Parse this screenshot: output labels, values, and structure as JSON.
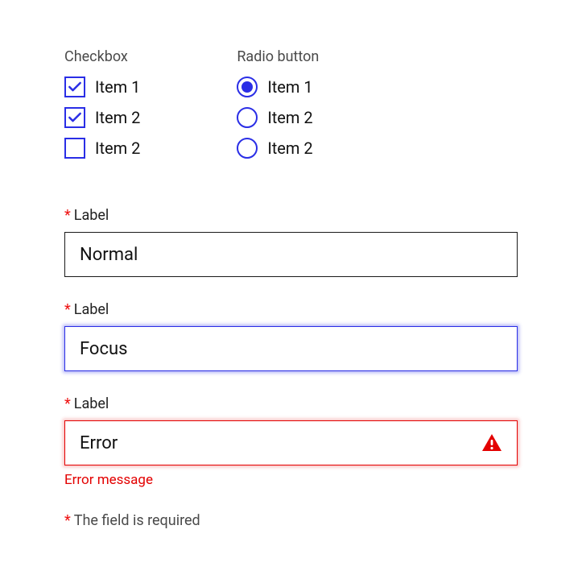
{
  "colors": {
    "accent": "#2a2ee6",
    "error": "#e30000",
    "text": "#111111",
    "muted": "#4a4a4a"
  },
  "checkbox_group": {
    "heading": "Checkbox",
    "items": [
      {
        "label": "Item 1",
        "checked": true
      },
      {
        "label": "Item 2",
        "checked": true
      },
      {
        "label": "Item 2",
        "checked": false
      }
    ]
  },
  "radio_group": {
    "heading": "Radio button",
    "items": [
      {
        "label": "Item 1",
        "selected": true
      },
      {
        "label": "Item 2",
        "selected": false
      },
      {
        "label": "Item 2",
        "selected": false
      }
    ]
  },
  "text_fields": {
    "normal": {
      "label": "Label",
      "required_mark": "*",
      "value": "Normal"
    },
    "focus": {
      "label": "Label",
      "required_mark": "*",
      "value": "Focus"
    },
    "error": {
      "label": "Label",
      "required_mark": "*",
      "value": "Error",
      "error_message": "Error message"
    }
  },
  "footnote": {
    "required_mark": "*",
    "text": "The field is required"
  }
}
